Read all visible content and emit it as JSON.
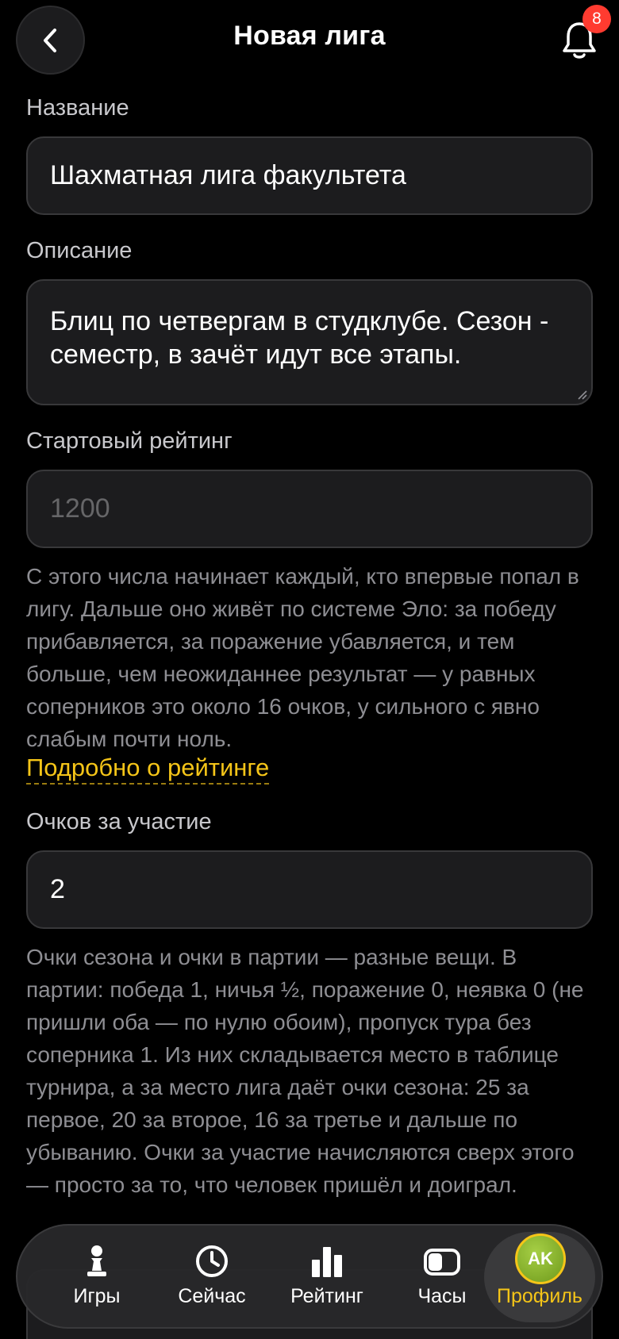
{
  "header": {
    "title": "Новая лига",
    "notifications_count": "8"
  },
  "form": {
    "name_label": "Название",
    "name_value": "Шахматная лига факультета",
    "description_label": "Описание",
    "description_value": "Блиц по четвергам в студклубе. Сезон - семестр, в зачёт идут все этапы.",
    "rating_label": "Стартовый рейтинг",
    "rating_placeholder": "1200",
    "rating_help": "С этого числа начинает каждый, кто впервые попал в лигу. Дальше оно живёт по системе Эло: за победу прибавляется, за поражение убавляется, и тем больше, чем неожиданнее результат — у равных соперников это около 16 очков, у сильного с явно слабым почти ноль.",
    "rating_link": "Подробно о рейтинге",
    "participation_label": "Очков за участие",
    "participation_value": "2",
    "participation_help": "Очки сезона и очки в партии — разные вещи. В партии: победа 1, ничья ½, поражение 0, неявка 0 (не пришли оба — по нулю обоим), пропуск тура без соперника 1. Из них складывается место в таблице турнира, а за место лига даёт очки сезона: 25 за первое, 20 за второе, 16 за третье и дальше по убыванию. Очки за участие начисляются сверх этого — просто за то, что человек пришёл и доиграл."
  },
  "tabbar": {
    "games": "Игры",
    "now": "Сейчас",
    "rating": "Рейтинг",
    "clock": "Часы",
    "profile": "Профиль",
    "avatar_initials": "AK"
  },
  "colors": {
    "accent": "#f5c518",
    "badge": "#ff3b30",
    "field_bg": "#1c1c1e"
  },
  "icons": {
    "back": "chevron-left-icon",
    "notifications": "bell-icon",
    "games": "chess-pawn-icon",
    "now": "clock-icon",
    "rating": "bar-chart-icon",
    "clock": "chess-clock-icon"
  }
}
